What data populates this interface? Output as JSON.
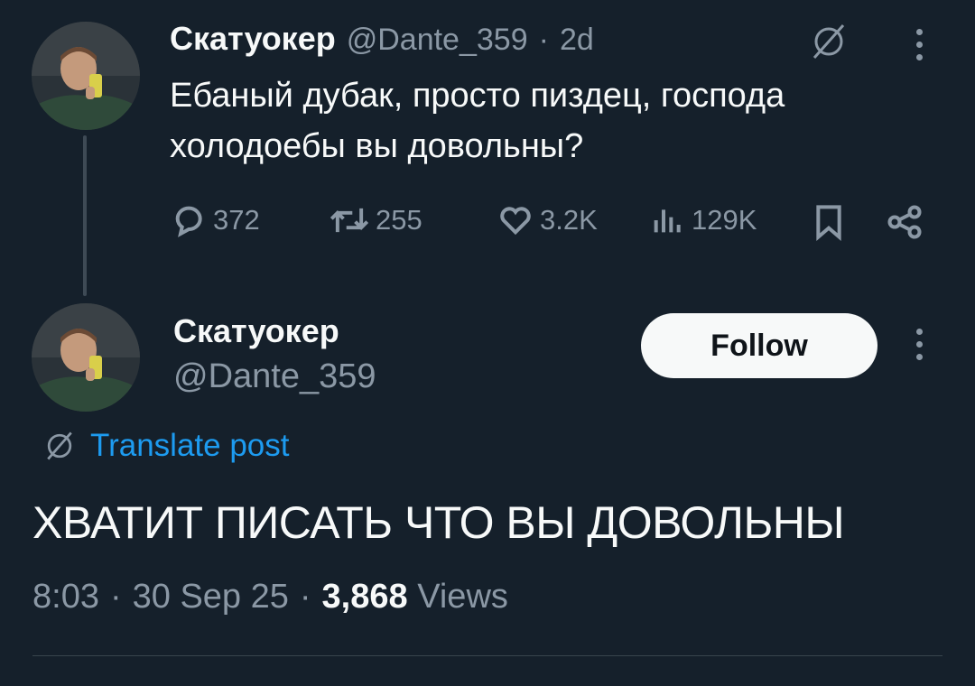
{
  "reply_tweet": {
    "author_name": "Скатуокер",
    "handle": "@Dante_359",
    "separator": "·",
    "time_ago": "2d",
    "text_line1": "Ебаный дубак, просто пиздец, господа",
    "text_line2": "холодоебы вы довольны?",
    "actions": {
      "replies": "372",
      "retweets": "255",
      "likes": "3.2K",
      "views": "129K"
    }
  },
  "main_tweet": {
    "author_name": "Скатуокер",
    "handle": "@Dante_359",
    "follow_label": "Follow",
    "translate_label": "Translate post",
    "text": "ХВАТИТ ПИСАТЬ ЧТО ВЫ ДОВОЛЬНЫ",
    "time": "8:03",
    "sep1": "·",
    "date": "30 Sep 25",
    "sep2": "·",
    "views_count": "3,868",
    "views_label": "Views"
  },
  "colors": {
    "background": "#15202b",
    "text": "#f7f9f9",
    "muted": "#8b98a5",
    "link": "#1d9bf0"
  }
}
